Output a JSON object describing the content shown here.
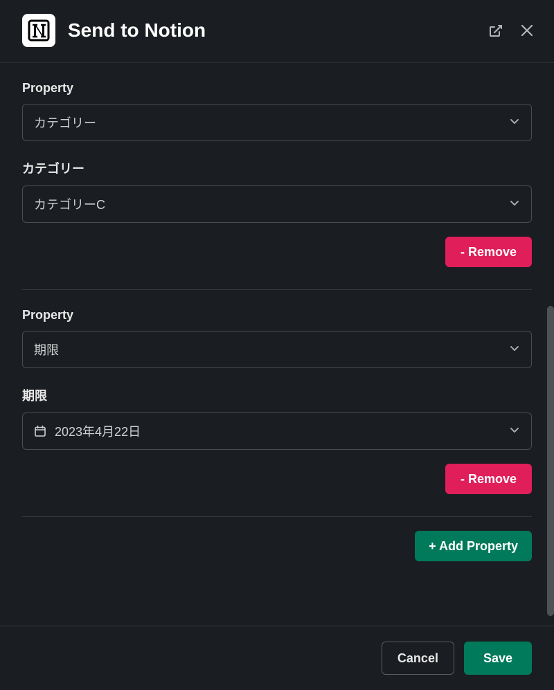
{
  "header": {
    "title": "Send to Notion"
  },
  "labels": {
    "property": "Property"
  },
  "blocks": [
    {
      "property_value": "カテゴリー",
      "field_label": "カテゴリー",
      "field_value": "カテゴリーC",
      "has_icon": false,
      "remove_label": "- Remove"
    },
    {
      "property_value": "期限",
      "field_label": "期限",
      "field_value": "2023年4月22日",
      "has_icon": true,
      "remove_label": "- Remove"
    }
  ],
  "add_property_label": "+ Add Property",
  "footer": {
    "cancel": "Cancel",
    "save": "Save"
  }
}
